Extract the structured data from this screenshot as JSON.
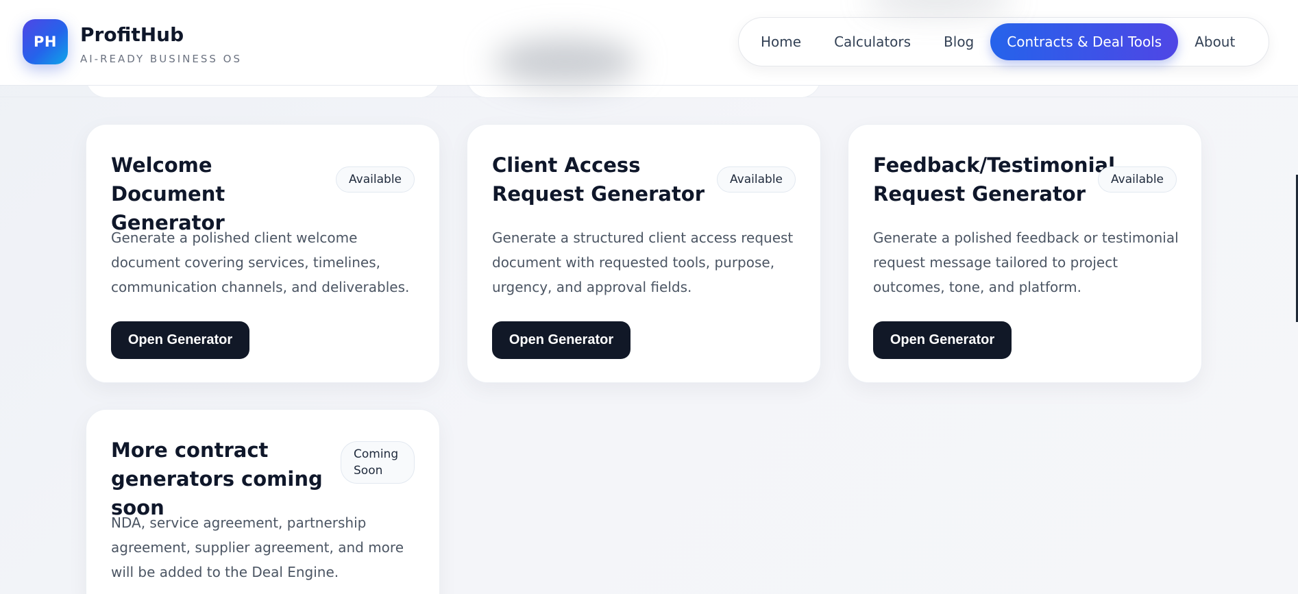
{
  "brand": {
    "logo_text": "PH",
    "name": "ProfitHub",
    "tagline": "AI-READY BUSINESS OS"
  },
  "nav": {
    "items": [
      {
        "label": "Home",
        "active": false
      },
      {
        "label": "Calculators",
        "active": false
      },
      {
        "label": "Blog",
        "active": false
      },
      {
        "label": "Contracts & Deal Tools",
        "active": true
      },
      {
        "label": "About",
        "active": false
      }
    ]
  },
  "cards": [
    {
      "title": "Welcome Document Generator",
      "badge": "Available",
      "description": "Generate a polished client welcome document covering services, timelines, communication channels, and deliverables.",
      "button": "Open Generator"
    },
    {
      "title": "Client Access Request Generator",
      "badge": "Available",
      "description": "Generate a structured client access request document with requested tools, purpose, urgency, and approval fields.",
      "button": "Open Generator"
    },
    {
      "title": "Feedback/Testimonial Request Generator",
      "badge": "Available",
      "description": "Generate a polished feedback or testimonial request message tailored to project outcomes, tone, and platform.",
      "button": "Open Generator"
    },
    {
      "title": "More contract generators coming soon",
      "badge": "Coming Soon",
      "description": "NDA, service agreement, partnership agreement, supplier agreement, and more will be added to the Deal Engine."
    }
  ],
  "colors": {
    "accent_start": "#2563eb",
    "accent_end": "#4f46e5",
    "button_dark": "#111827"
  }
}
